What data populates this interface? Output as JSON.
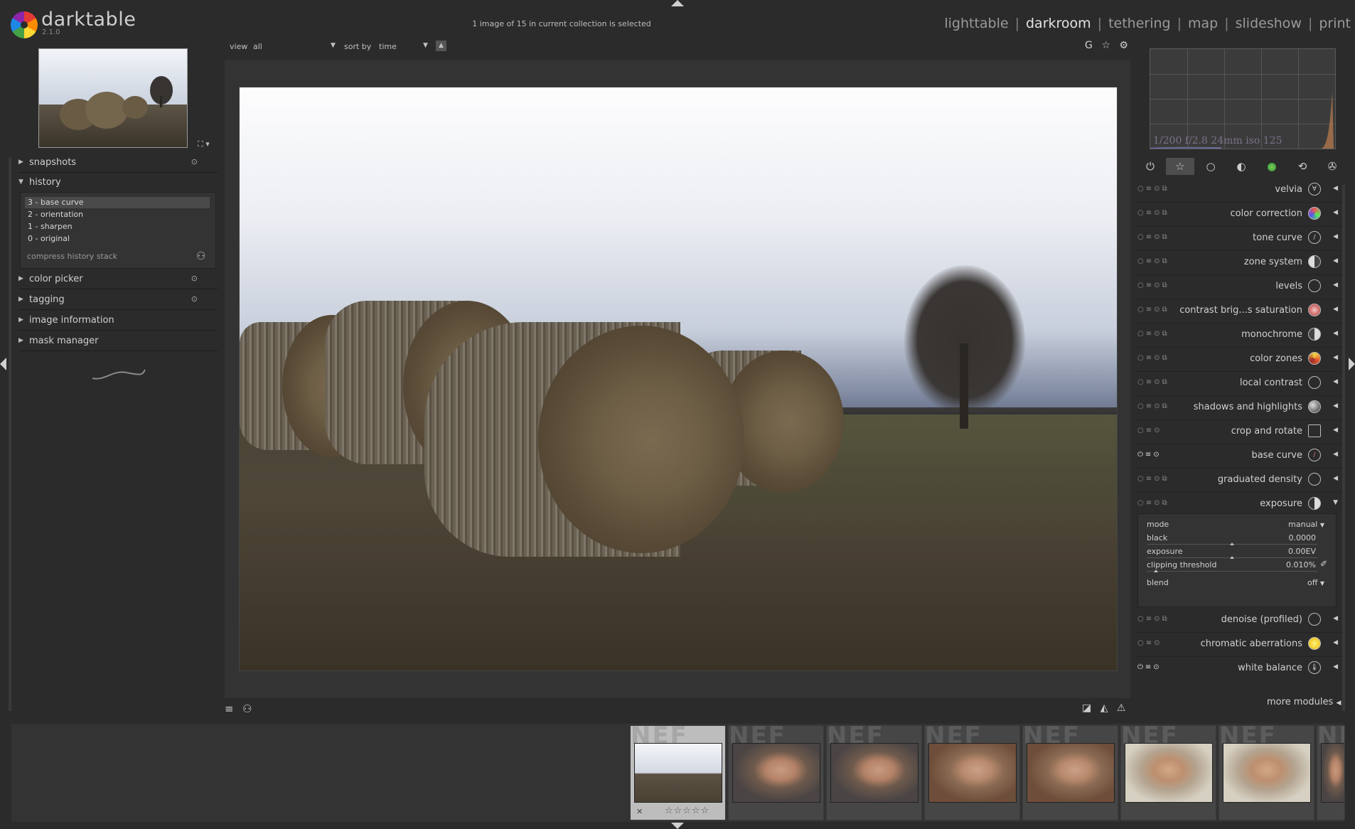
{
  "app": {
    "name": "darktable",
    "version": "2.1.0"
  },
  "header": {
    "selection_status": "1 image of 15 in current collection is selected",
    "views": [
      "lighttable",
      "darkroom",
      "tethering",
      "map",
      "slideshow",
      "print"
    ],
    "active_view": "darkroom",
    "separator": "|"
  },
  "left_panel": {
    "modules": [
      {
        "label": "snapshots",
        "expanded": false,
        "has_power": true
      },
      {
        "label": "history",
        "expanded": true,
        "has_power": false
      },
      {
        "label": "color picker",
        "expanded": false,
        "has_power": true
      },
      {
        "label": "tagging",
        "expanded": false,
        "has_power": true
      },
      {
        "label": "image information",
        "expanded": false,
        "has_power": false
      },
      {
        "label": "mask manager",
        "expanded": false,
        "has_power": false
      }
    ],
    "history": {
      "items": [
        "3 - base curve",
        "2 - orientation",
        "1 - sharpen",
        "0 - original"
      ],
      "selected_index": 0,
      "compress_label": "compress history stack"
    }
  },
  "filter_bar": {
    "view_label": "view",
    "view_value": "all",
    "sort_label": "sort by",
    "sort_value": "time"
  },
  "center_tools": {
    "guides": "G"
  },
  "right_panel": {
    "histogram_info": "1/200 f/2.8 24mm iso 125",
    "modules": [
      {
        "label": "velvia",
        "enabled": false
      },
      {
        "label": "color correction",
        "enabled": false
      },
      {
        "label": "tone curve",
        "enabled": false
      },
      {
        "label": "zone system",
        "enabled": false
      },
      {
        "label": "levels",
        "enabled": false
      },
      {
        "label": "contrast brig...s saturation",
        "enabled": false
      },
      {
        "label": "monochrome",
        "enabled": false
      },
      {
        "label": "color zones",
        "enabled": false
      },
      {
        "label": "local contrast",
        "enabled": false
      },
      {
        "label": "shadows and highlights",
        "enabled": false
      },
      {
        "label": "crop and rotate",
        "enabled": false
      },
      {
        "label": "base curve",
        "enabled": true
      },
      {
        "label": "graduated density",
        "enabled": false
      },
      {
        "label": "exposure",
        "enabled": false,
        "expanded": true
      },
      {
        "label": "denoise (profiled)",
        "enabled": false
      },
      {
        "label": "chromatic aberrations",
        "enabled": false
      },
      {
        "label": "white balance",
        "enabled": true
      }
    ],
    "exposure_panel": {
      "mode_label": "mode",
      "mode_value": "manual",
      "black_label": "black",
      "black_value": "0.0000",
      "exposure_label": "exposure",
      "exposure_value": "0.00EV",
      "clipping_label": "clipping threshold",
      "clipping_value": "0.010%",
      "blend_label": "blend",
      "blend_value": "off"
    },
    "more_modules": "more modules"
  },
  "filmstrip": {
    "ghost_label": "NEF",
    "thumbnails": 7,
    "current_index": 0
  }
}
